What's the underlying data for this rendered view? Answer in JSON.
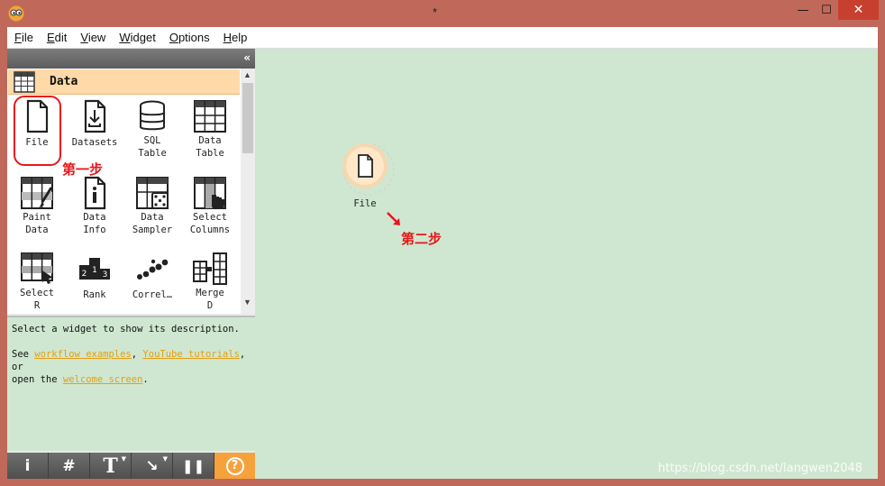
{
  "window": {
    "title": "*",
    "minimize": "—",
    "maximize": "☐",
    "close": "✕"
  },
  "menu": [
    {
      "label": "File",
      "key": "F",
      "rest": "ile"
    },
    {
      "label": "Edit",
      "key": "E",
      "rest": "dit"
    },
    {
      "label": "View",
      "key": "V",
      "rest": "iew"
    },
    {
      "label": "Widget",
      "key": "W",
      "rest": "idget"
    },
    {
      "label": "Options",
      "key": "O",
      "rest": "ptions"
    },
    {
      "label": "Help",
      "key": "H",
      "rest": "elp"
    }
  ],
  "dock": {
    "collapse": "«",
    "category": "Data"
  },
  "widgets": {
    "file": {
      "label": "File",
      "icon": "file-icon"
    },
    "datasets": {
      "label": "Datasets",
      "icon": "download-file-icon"
    },
    "sql_table": {
      "label": "SQL\nTable",
      "icon": "database-icon"
    },
    "data_table": {
      "label": "Data\nTable",
      "icon": "table-icon"
    },
    "paint_data": {
      "label": "Paint\nData",
      "icon": "paintbrush-table-icon"
    },
    "data_info": {
      "label": "Data\nInfo",
      "icon": "info-file-icon"
    },
    "data_sampler": {
      "label": "Data\nSampler",
      "icon": "dice-table-icon"
    },
    "select_columns": {
      "label": "Select\nColumns",
      "icon": "hand-column-icon"
    },
    "select_rows": {
      "label": "Select\nR",
      "icon": "hand-rows-icon"
    },
    "rank": {
      "label": "Rank",
      "icon": "podium-icon"
    },
    "correlations": {
      "label": "Correl…",
      "icon": "scatter-dots-icon"
    },
    "merge_data": {
      "label": "Merge\nD",
      "icon": "merge-tables-icon"
    }
  },
  "description": {
    "line1": "Select a widget to show its description.",
    "see": "See ",
    "link1": "workflow examples",
    "comma": ", ",
    "link2": "YouTube tutorials",
    "or": ", or",
    "open": "open the ",
    "link3": "welcome screen",
    "period": "."
  },
  "toolbar": [
    {
      "label": "i",
      "icon": "info-icon"
    },
    {
      "label": "#",
      "icon": "grid-icon"
    },
    {
      "label": "T",
      "icon": "text-icon"
    },
    {
      "label": "↘",
      "icon": "arrow-icon"
    },
    {
      "label": "❚❚",
      "icon": "pause-icon"
    },
    {
      "label": "?",
      "icon": "help-icon"
    }
  ],
  "canvas": {
    "node_label": "File"
  },
  "annotations": {
    "step1": "第一步",
    "step2": "第二步"
  },
  "watermark": "https://blog.csdn.net/langwen2048",
  "colors": {
    "titlebar": "#c0695a",
    "canvas_bg": "#cfe7d0",
    "category_bg": "#ffd9a8",
    "accent": "#f6a23c",
    "annotation": "#e8161a",
    "link": "#e59e12"
  }
}
